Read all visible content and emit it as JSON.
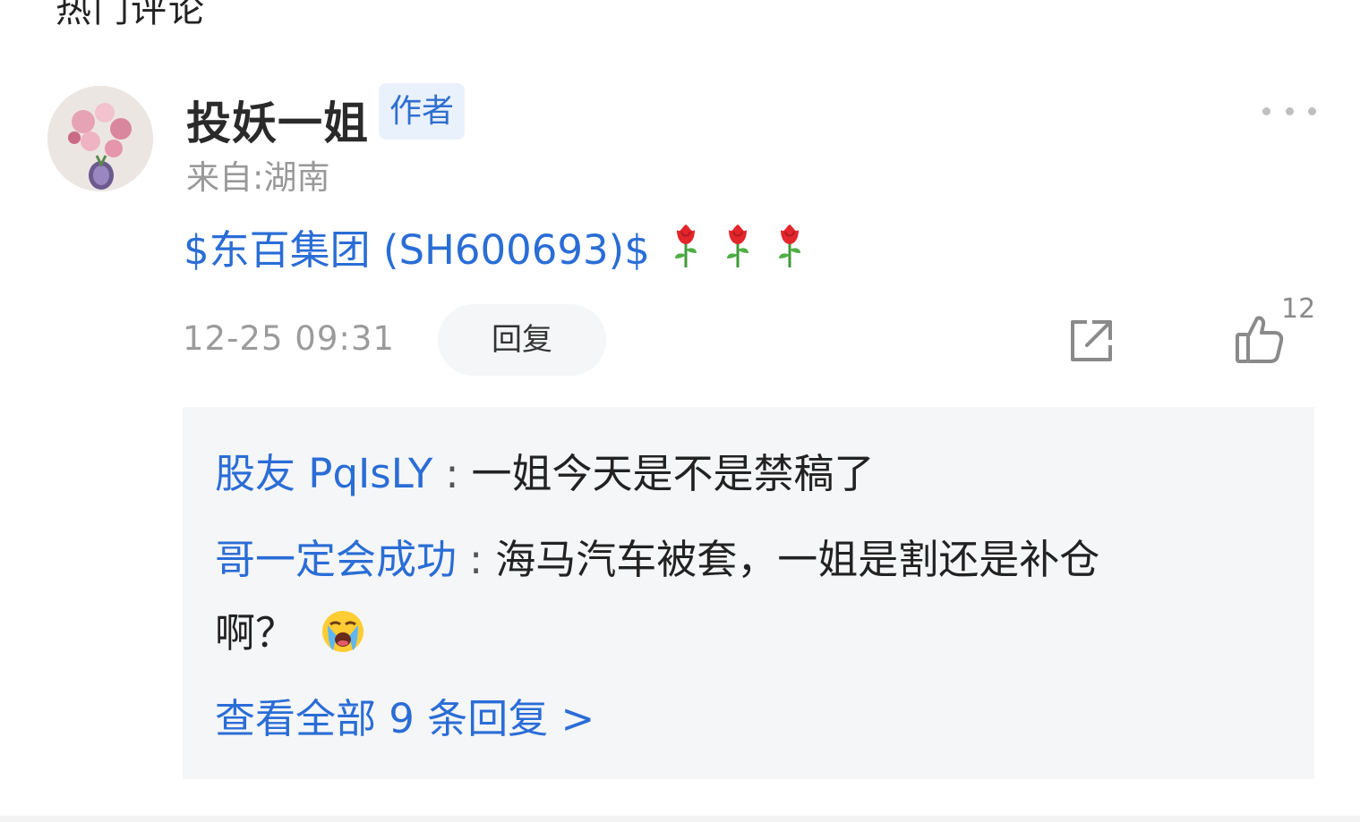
{
  "section": {
    "title": "热门评论"
  },
  "comment": {
    "username": "投妖一姐",
    "author_badge": "作者",
    "location": "来自:湖南",
    "stock_link": "$东百集团 (SH600693)$",
    "emojis": [
      "rose-emoji",
      "rose-emoji",
      "rose-emoji"
    ],
    "timestamp": "12-25 09:31",
    "reply_button": "回复",
    "like_count": "12"
  },
  "replies": {
    "items": [
      {
        "user": "股友 PqIsLY",
        "separator": ":",
        "text": "一姐今天是不是禁稿了"
      },
      {
        "user": "哥一定会成功",
        "separator": ":",
        "text": "海马汽车被套，一姐是割还是补仓",
        "text_cont": "啊？",
        "emoji": "crying-face-emoji"
      }
    ],
    "view_all": "查看全部 9 条回复 >"
  },
  "colors": {
    "link_blue": "#2a6dd6",
    "badge_bg": "#e9f1fd",
    "reply_bg": "#f5f6f8",
    "muted_text": "#9b9b9b"
  },
  "icons": [
    "more-icon",
    "share-icon",
    "thumbs-up-icon"
  ]
}
